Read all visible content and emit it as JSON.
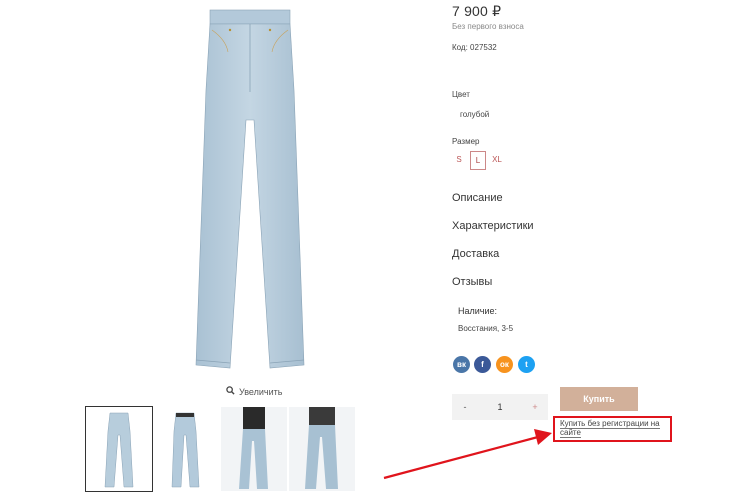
{
  "product": {
    "price": "7 900 ₽",
    "price_note": "Без первого взноса",
    "code": "Код: 027532",
    "color_label": "Цвет",
    "color_value": "голубой",
    "size_label": "Размер",
    "sizes": [
      "S",
      "L",
      "XL"
    ],
    "selected_size": "L"
  },
  "gallery": {
    "zoom_label": "Увеличить",
    "thumbnail_count": 4,
    "selected_index": 0
  },
  "sections": [
    "Описание",
    "Характеристики",
    "Доставка",
    "Отзывы"
  ],
  "availability": {
    "label": "Наличие:",
    "store": "Восстания, 3-5"
  },
  "social": [
    {
      "icon": "vk-icon",
      "glyph": "вк",
      "color": "#4a76a8"
    },
    {
      "icon": "facebook-icon",
      "glyph": "f",
      "color": "#3b5998"
    },
    {
      "icon": "odnoklassniki-icon",
      "glyph": "ок",
      "color": "#f7931e"
    },
    {
      "icon": "twitter-icon",
      "glyph": "t",
      "color": "#1da1f2"
    }
  ],
  "cart": {
    "minus": "-",
    "quantity": "1",
    "plus": "+",
    "buy_label": "Купить",
    "quick_buy": "Купить без регистрации на сайте"
  },
  "colors": {
    "denim": "#b7cddc",
    "buy_button": "#d2b09a",
    "highlight": "#e0141c"
  }
}
